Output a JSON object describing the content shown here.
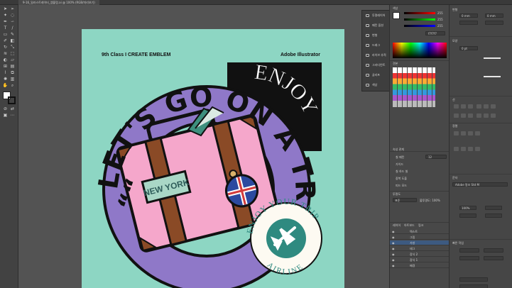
{
  "document": {
    "tab_title": "9-16_일러스트레이터_엠블럼.ai @ 100% (RGB/미리보기)"
  },
  "artboard": {
    "header_left": "9th Class  I  CREATE EMBLEM",
    "header_right": "Adobe Illustrator"
  },
  "emblem": {
    "ring_text": "LET'S GO ON A TRIP NOW",
    "quote_mark": "““",
    "banner_text": "ENJOY",
    "tag_text": "NEW YORK",
    "badge_top_text": "ENJOY YOUR TRIP",
    "badge_bottom_text": "AIRLINE"
  },
  "context_menu": {
    "items": [
      "투명레이어",
      "패턴 옵션",
      "변형",
      "드래그",
      "라이브 추적",
      "그라디언트",
      "글리프",
      "색상"
    ]
  },
  "color_panel": {
    "title": "색상",
    "hex_value": "f7f7f7",
    "slider_values": [
      "255",
      "255",
      "255"
    ]
  },
  "swatch_panel": {
    "title": "견본"
  },
  "appearance_panel": {
    "title": "속성 관계",
    "rows": [
      "칠 패턴",
      "가이드",
      "칠 하드 칠",
      "중복 도출",
      "피드 모드"
    ],
    "value": "12"
  },
  "transparency_panel": {
    "title": "투명도",
    "mode": "표준",
    "opacity": "불투명도: 100%"
  },
  "layers_panel": {
    "tabs": [
      "레이어",
      "아트보드",
      "링크"
    ],
    "layers": [
      "텍스트",
      "그림",
      "가방",
      "태그",
      "장식 2",
      "장식 1",
      "배경"
    ]
  },
  "properties_panel": {
    "sections": [
      "변형",
      "모양",
      "선",
      "문자",
      "정렬",
      "빠른 작업"
    ],
    "font_name": "Adobe 명조 Std M",
    "font_size": "100%",
    "width_value": "0 pt",
    "x_value": "0 mm",
    "y_value": "0 mm"
  },
  "colors": {
    "artboard": "#8dd6c3",
    "ring": "#8f78c8",
    "ring_text": "#111111",
    "suitcase": "#f5a7cb",
    "strap": "#8a4a26",
    "badge": "#2f8a80",
    "banner": "#111111"
  }
}
